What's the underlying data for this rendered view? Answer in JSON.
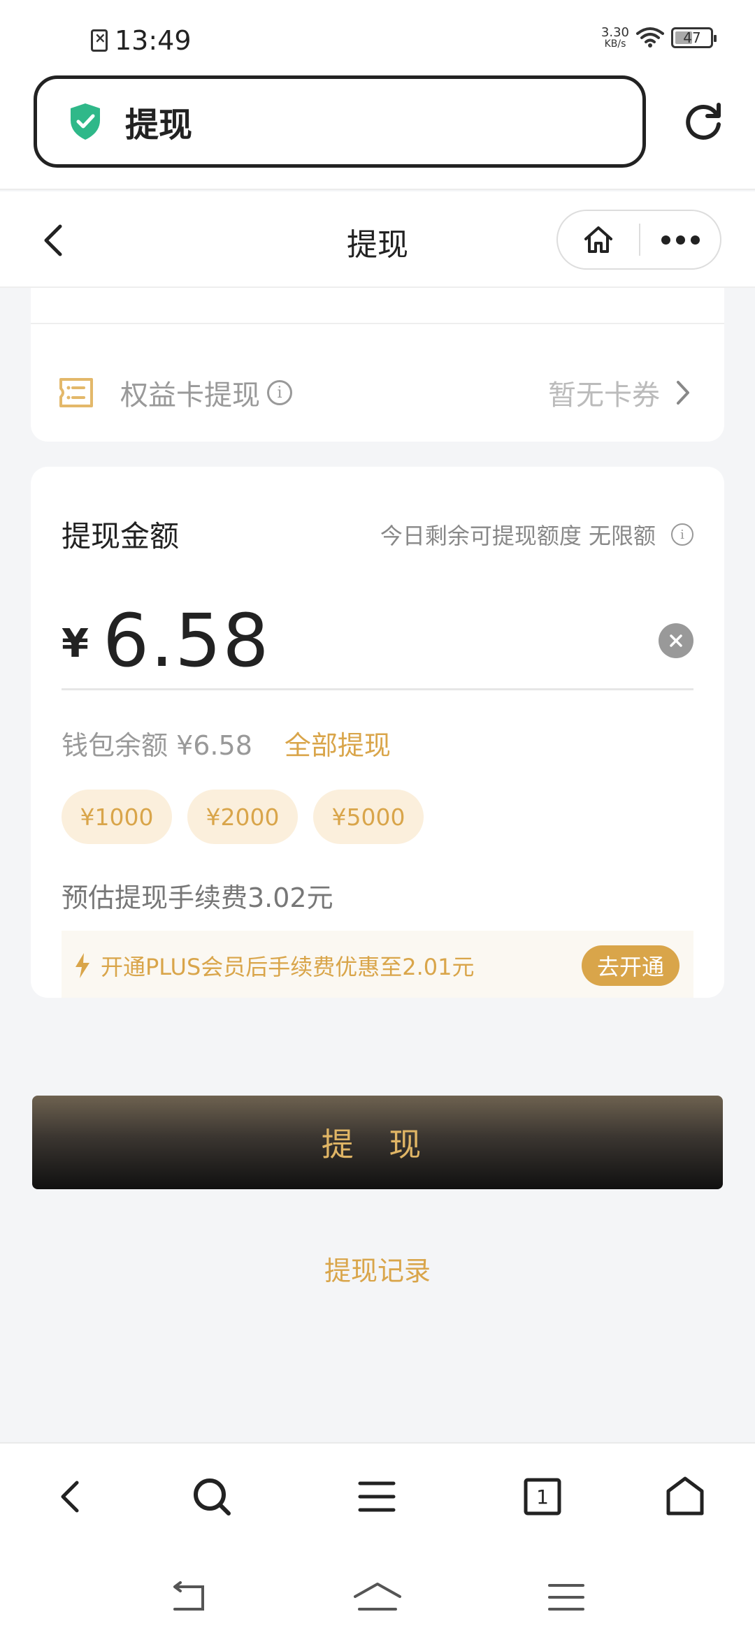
{
  "status_bar": {
    "time": "13:49",
    "net_speed_value": "3.30",
    "net_speed_unit": "KB/s",
    "battery": "47"
  },
  "browser": {
    "url_title": "提现",
    "shield_icon": "shield-check-icon",
    "refresh_icon": "refresh-icon"
  },
  "header": {
    "title": "提现",
    "back_icon": "chevron-left-icon",
    "home_icon": "home-icon",
    "more_icon": "more-dots-icon"
  },
  "rights_card": {
    "label": "权益卡提现",
    "value": "暂无卡券",
    "icon": "ticket-icon"
  },
  "amount_card": {
    "title": "提现金额",
    "quota_text": "今日剩余可提现额度 无限额",
    "currency": "¥",
    "amount": "6.58",
    "balance": "钱包余额 ¥6.58",
    "withdraw_all": "全部提现",
    "chips": [
      "¥1000",
      "¥2000",
      "¥5000"
    ],
    "fee": "预估提现手续费3.02元",
    "promo_text": "开通PLUS会员后手续费优惠至2.01元",
    "promo_button": "去开通"
  },
  "actions": {
    "withdraw_button": "提 现",
    "records_link": "提现记录"
  },
  "bottom_nav": {
    "tab_count": "1"
  },
  "colors": {
    "accent_gold": "#d9a54a",
    "shield_green": "#2fb889"
  }
}
